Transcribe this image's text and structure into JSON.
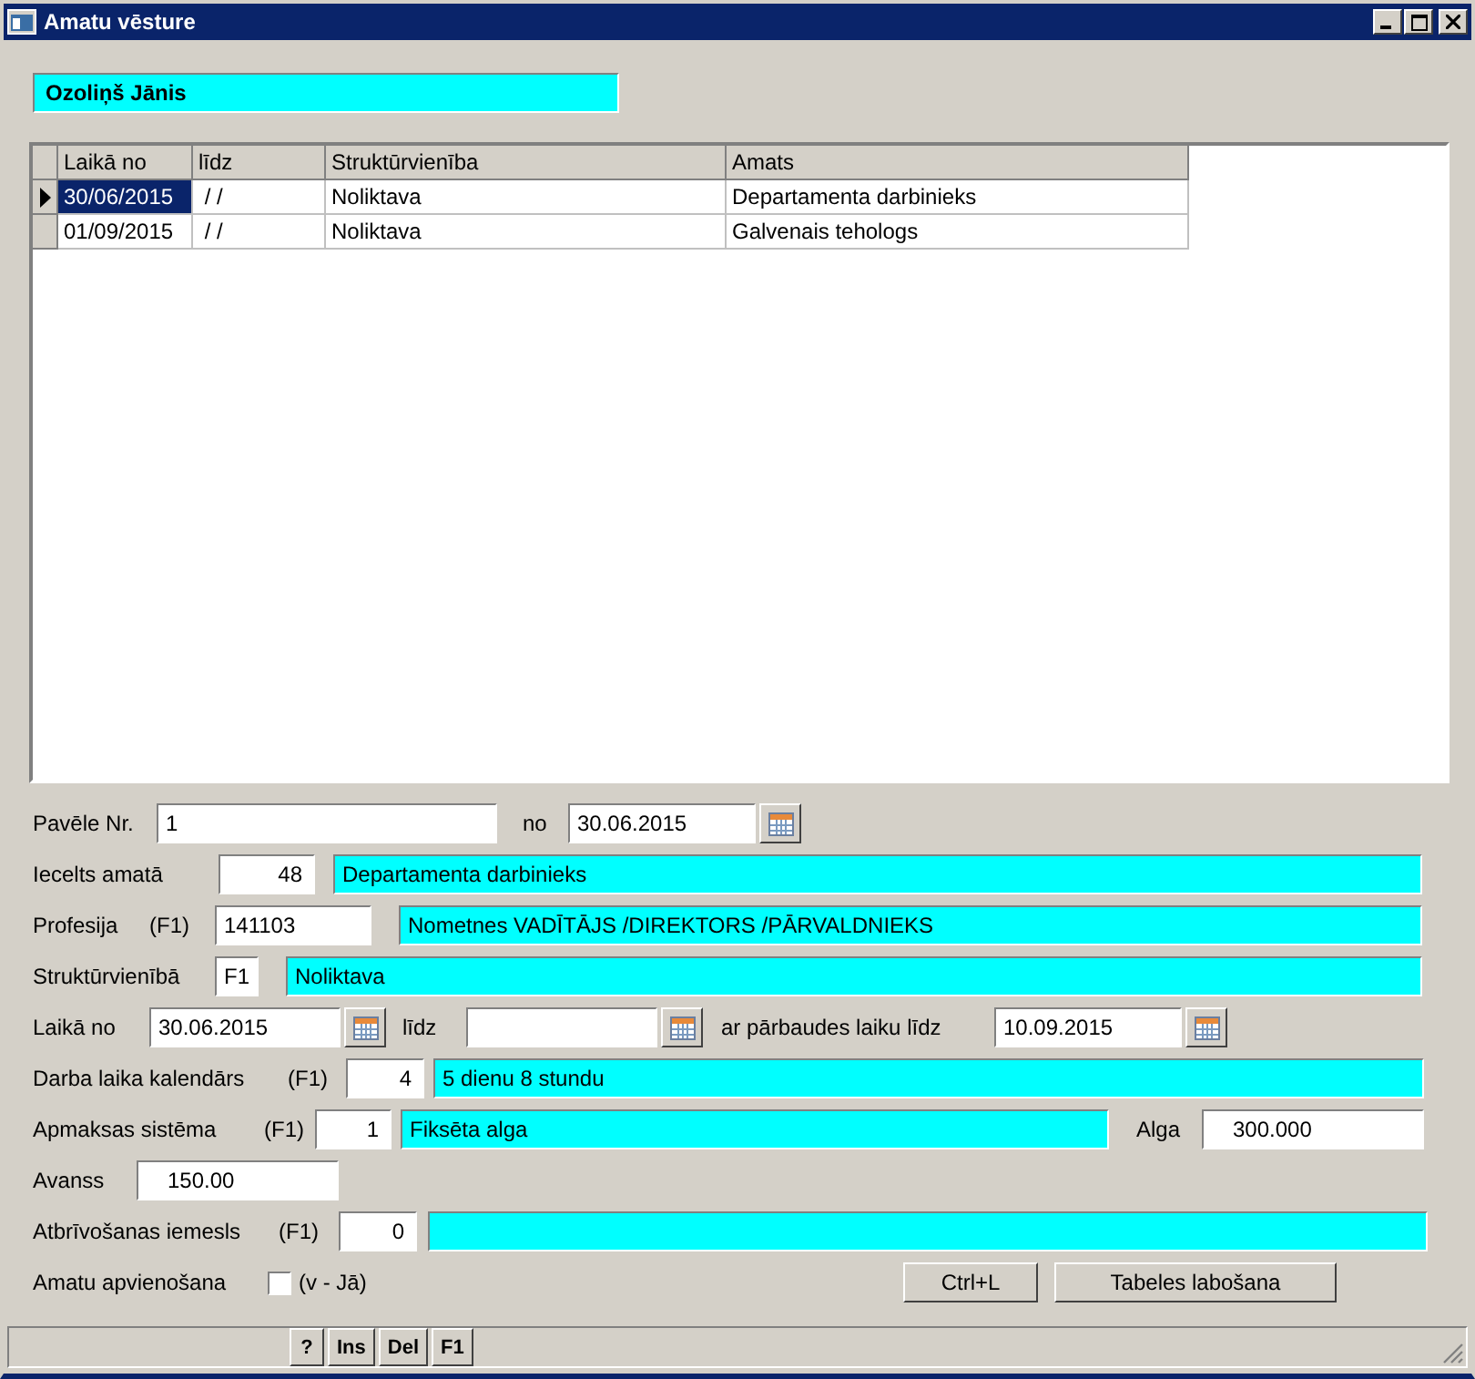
{
  "window": {
    "title": "Amatu vēsture"
  },
  "employee_name": "Ozoliņš Jānis",
  "history_table": {
    "columns": [
      "Laikā no",
      "līdz",
      "Struktūrvienība",
      "Amats"
    ],
    "rows": [
      {
        "selected": true,
        "cells": [
          "30/06/2015",
          " / /",
          "Noliktava",
          "Departamenta darbinieks"
        ]
      },
      {
        "selected": false,
        "cells": [
          "01/09/2015",
          " / /",
          "Noliktava",
          "Galvenais tehologs"
        ]
      }
    ]
  },
  "form": {
    "order_no": {
      "label": "Pavēle Nr.",
      "value": "1"
    },
    "order_date": {
      "label": "no",
      "value": "30.06.2015"
    },
    "position": {
      "label": "Iecelts amatā",
      "code": "48",
      "name": "Departamenta darbinieks"
    },
    "profession": {
      "label": "Profesija",
      "hint": "(F1)",
      "code": "141103",
      "name": "Nometnes VADĪTĀJS /DIREKTORS /PĀRVALDNIEKS"
    },
    "department": {
      "label": "Struktūrvienībā",
      "code": "F1",
      "name": "Noliktava"
    },
    "period": {
      "from_label": "Laikā no",
      "from": "30.06.2015",
      "to_label": "līdz",
      "probation_label": "ar pārbaudes laiku līdz",
      "probation": "10.09.2015"
    },
    "work_calendar": {
      "label": "Darba laika kalendārs",
      "hint": "(F1)",
      "code": "4",
      "name": "5 dienu 8 stundu"
    },
    "payment_system": {
      "label": "Apmaksas sistēma",
      "hint": "(F1)",
      "code": "1",
      "name": "Fiksēta alga"
    },
    "salary": {
      "label": "Alga",
      "value": "300.000"
    },
    "advance": {
      "label": "Avanss",
      "value": "150.00"
    },
    "dismissal_reason": {
      "label": "Atbrīvošanas iemesls",
      "hint": "(F1)",
      "code": "0"
    },
    "combined": {
      "label": "Amatu apvienošana",
      "checked": false,
      "hint": "(v - Jā)"
    }
  },
  "buttons": [
    "Ctrl+L",
    "Tabeles labošana"
  ],
  "status_bar": {
    "keys": [
      "?",
      "Ins",
      "Del",
      "F1"
    ]
  }
}
